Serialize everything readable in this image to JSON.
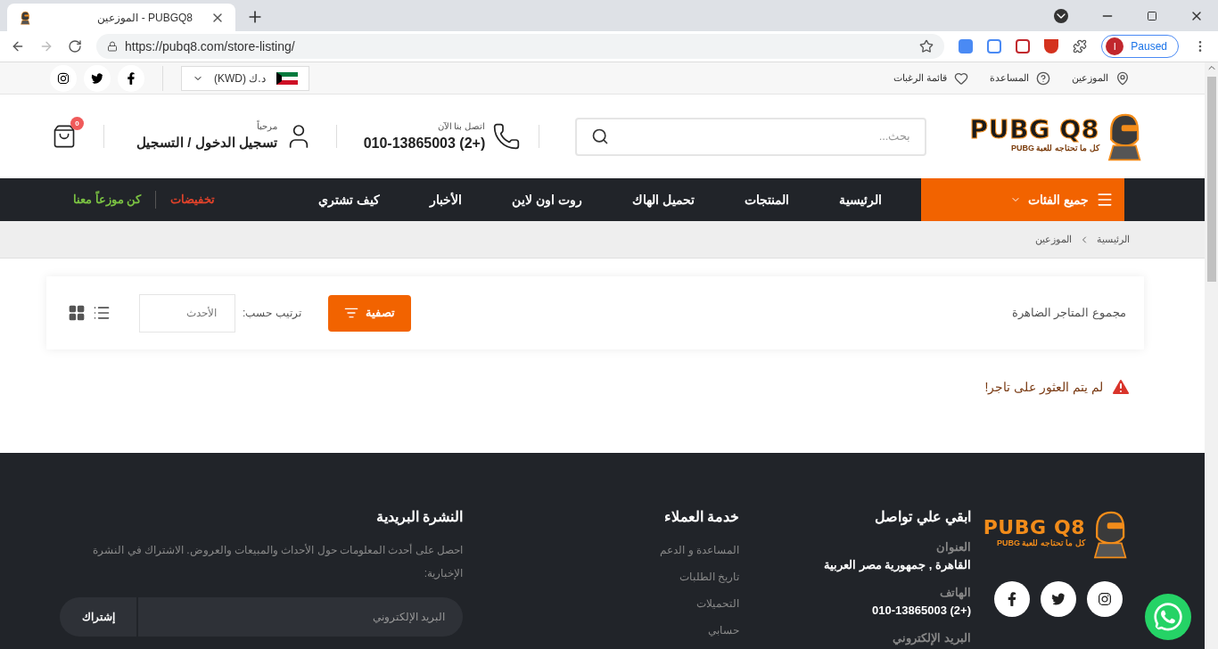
{
  "browser": {
    "tab_title": "الموزعين - PUBGQ8",
    "url": "https://pubq8.com/store-listing/",
    "profile_initial": "I",
    "profile_label": "Paused"
  },
  "topbar": {
    "links": [
      {
        "kind": "pin",
        "label": "الموزعين"
      },
      {
        "kind": "help",
        "label": "المساعدة"
      },
      {
        "kind": "heart",
        "label": "قائمة الرغبات"
      }
    ],
    "currency": "د.ك (KWD)"
  },
  "header": {
    "logo_text": "PUBG Q8",
    "logo_tagline": "كل ما تحتاجه للعبة PUBG",
    "search": {
      "placeholder": "بحث..."
    },
    "contact_label": "اتصل بنا الآن",
    "phone": "010-13865003 (2+)",
    "greeting": "مرحباً",
    "login": "تسجيل الدخول / التسجيل",
    "cart_count": "0"
  },
  "nav": {
    "categories": "جميع الفئات",
    "items": [
      "الرئيسية",
      "المنتجات",
      "تحميل الهاك",
      "روت اون لاين",
      "الأخبار",
      "كيف تشتري"
    ],
    "extras": [
      {
        "label": "تخفيضات",
        "color": "#e0422a"
      },
      {
        "label": "كن موزعاً معنا",
        "color": "#7ac142"
      }
    ]
  },
  "breadcrumb": [
    "الرئيسية",
    "الموزعين"
  ],
  "toolbar": {
    "count_label": "مجموع المتاجر الضاهرة",
    "filter": "تصفية",
    "sort_label": "ترتيب حسب:",
    "sort_value": "الأحدث"
  },
  "notice": "لم يتم العثور على تاجر!",
  "footer": {
    "logo_text": "PUBG Q8",
    "logo_tagline": "كل ما تحتاجه للعبة PUBG",
    "contact": {
      "title": "ابقي علي تواصل",
      "fields": [
        {
          "label": "العنوان",
          "value": "القاهرة , جمهورية مصر العربية"
        },
        {
          "label": "الهاتف",
          "value": "010-13865003 (2+)"
        },
        {
          "label": "البريد الإلكتروني"
        }
      ]
    },
    "service": {
      "title": "خدمة العملاء",
      "links": [
        "المساعدة و الدعم",
        "تاريخ الطلبات",
        "التحميلات",
        "حسابي"
      ]
    },
    "newsletter": {
      "title": "النشرة البريدية",
      "text": "احصل على أحدث المعلومات حول الأحداث والمبيعات والعروض. الاشتراك في النشرة الإخبارية:",
      "placeholder": "البريد الإلكتروني",
      "button": "إشتراك"
    }
  }
}
